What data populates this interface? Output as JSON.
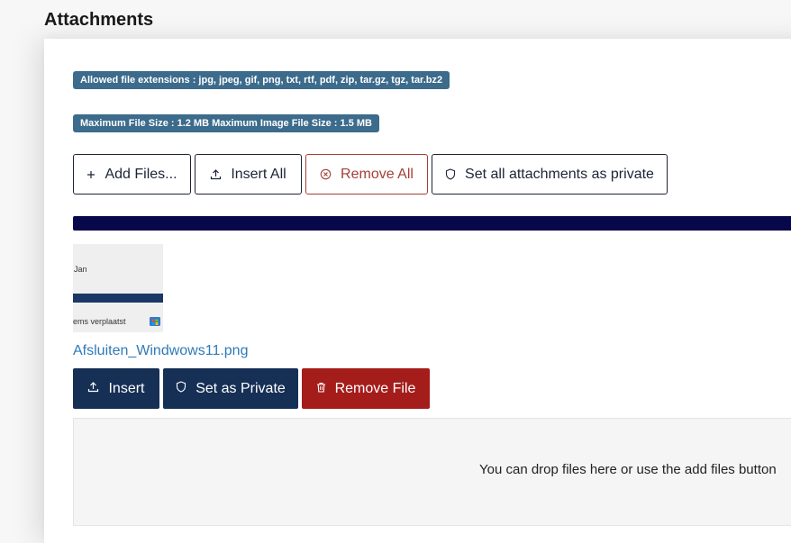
{
  "section": {
    "title": "Attachments"
  },
  "info": {
    "extensions": "Allowed file extensions : jpg, jpeg, gif, png, txt, rtf, pdf, zip, tar.gz, tgz, tar.bz2",
    "sizes": "Maximum File Size : 1.2 MB Maximum Image File Size : 1.5 MB"
  },
  "toolbar": {
    "add_files": "Add Files...",
    "insert_all": "Insert All",
    "remove_all": "Remove All",
    "set_all_private": "Set all attachments as private"
  },
  "upload": {
    "progress": 1.0
  },
  "file": {
    "thumbnail_text_top": "Jan",
    "thumbnail_text_bottom": "ems verplaatst",
    "name": "Afsluiten_Windwows11.png",
    "insert": "Insert",
    "set_private": "Set as Private",
    "remove": "Remove File"
  },
  "dropzone": {
    "text": "You can drop files here or use the add files button"
  },
  "colors": {
    "badge": "#3c6b8c",
    "navy_button": "#162f55",
    "danger_button": "#a41d1a",
    "progress": "#06084a",
    "link": "#2d7ab8"
  },
  "icons": {
    "add": "plus-icon",
    "insert": "upload-icon",
    "remove_all": "circle-x-icon",
    "private": "shield-icon",
    "remove_file": "trash-icon"
  }
}
